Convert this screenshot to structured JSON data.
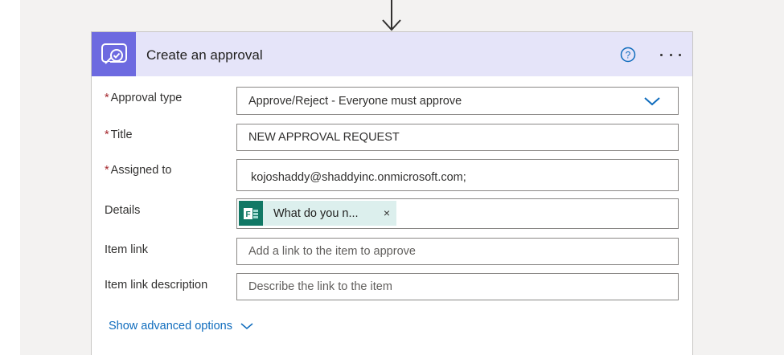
{
  "card": {
    "title": "Create an approval",
    "icon": "approval-icon",
    "help_icon": "help-icon",
    "more_icon": "more-options-icon",
    "colors": {
      "icon_bg": "#6d6ae0",
      "header_bg": "#e5e4f9",
      "required": "#a4262c",
      "link": "#0f6cbd",
      "token_bg": "#dcefed",
      "token_icon_bg": "#117865"
    }
  },
  "fields": {
    "approval_type": {
      "label": "Approval type",
      "required_mark": "*",
      "value": "Approve/Reject - Everyone must approve"
    },
    "title": {
      "label": "Title",
      "required_mark": "*",
      "value": "NEW APPROVAL REQUEST"
    },
    "assigned_to": {
      "label": "Assigned to",
      "required_mark": "*",
      "value": "kojoshaddy@shaddyinc.onmicrosoft.com;"
    },
    "details": {
      "label": "Details",
      "token_label": "What do you n...",
      "token_icon": "microsoft-forms-icon",
      "token_close": "×"
    },
    "item_link": {
      "label": "Item link",
      "placeholder": "Add a link to the item to approve"
    },
    "item_link_description": {
      "label": "Item link description",
      "placeholder": "Describe the link to the item"
    }
  },
  "advanced": {
    "label": "Show advanced options"
  }
}
